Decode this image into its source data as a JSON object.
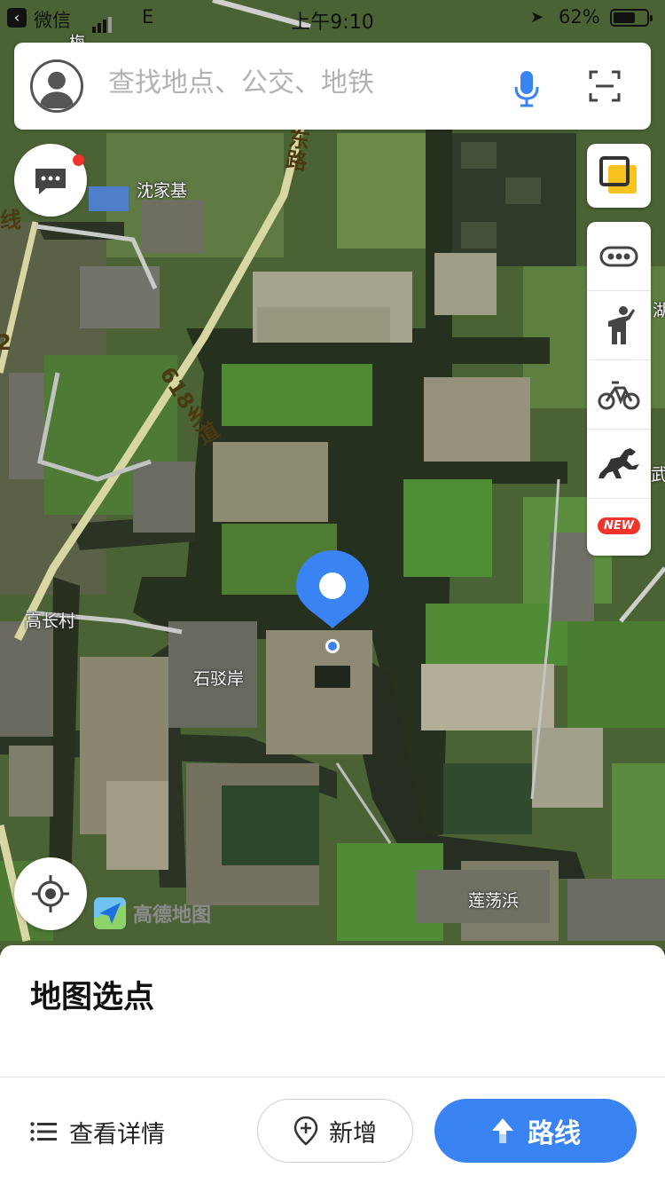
{
  "status_bar": {
    "back_app": "微信",
    "network": "E",
    "time": "上午9:10",
    "battery": "62%"
  },
  "search": {
    "placeholder": "查找地点、公交、地铁"
  },
  "map": {
    "places": [
      "沈家基",
      "高长村",
      "石驳岸",
      "莲荡浜"
    ],
    "roads": [
      "东路",
      "618乡道"
    ],
    "edge_labels": [
      "线",
      "2",
      "2",
      "梅",
      "武",
      "湖"
    ],
    "logo_text": "高德地图"
  },
  "side_tools": [
    "more-icon",
    "walking-icon",
    "bicycle-icon",
    "horse-icon"
  ],
  "new_badge": "NEW",
  "panel": {
    "title": "地图选点",
    "details_label": "查看详情",
    "add_label": "新增",
    "route_label": "路线"
  },
  "colors": {
    "accent": "#3a83f2",
    "badge_red": "#f0342c",
    "layer_yellow": "#f7c31c"
  }
}
